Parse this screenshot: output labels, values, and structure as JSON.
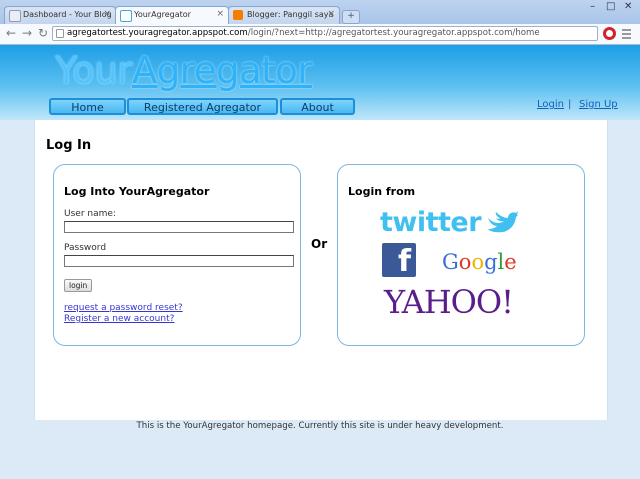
{
  "browser": {
    "tabs": [
      {
        "title": "Dashboard - Your Blog",
        "icon": "blogger-dashboard-icon",
        "active": false
      },
      {
        "title": "YourAgregator",
        "icon": "page-icon",
        "active": true
      },
      {
        "title": "Blogger: Panggil saya",
        "icon": "blogger-icon",
        "active": false
      }
    ],
    "new_tab": "+",
    "url_host": "agregatortest.youragregator.appspot.com",
    "url_rest": "/login/?next=http://agregatortest.youragregator.appspot.com/home",
    "win_minimize": "–",
    "win_maximize": "□",
    "win_close": "✕",
    "back": "←",
    "forward": "→",
    "reload": "↻",
    "close_glyph": "×"
  },
  "header": {
    "logo_part1": "Your",
    "logo_part2": "Agregator",
    "nav": [
      "Home",
      "Registered Agregator",
      "About"
    ],
    "login_link": "Login",
    "separator": "|",
    "signup_link": "Sign Up"
  },
  "main": {
    "page_title": "Log In",
    "login_panel": {
      "heading": "Log Into YourAgregator",
      "username_label": "User name:",
      "password_label": "Password",
      "username_value": "",
      "password_value": "",
      "submit_label": "login",
      "reset_link": "request a password reset?",
      "register_link": "Register a new account?"
    },
    "or_text": "Or",
    "providers": {
      "heading": "Login from",
      "twitter": "twitter",
      "facebook": "f",
      "google_letters": [
        "G",
        "o",
        "o",
        "g",
        "l",
        "e"
      ],
      "yahoo": "YAHOO!"
    }
  },
  "footer": {
    "text": "This is the YourAgregator homepage. Currently this site is under heavy development."
  },
  "colors": {
    "google": [
      "#3a6fd8",
      "#d83a2a",
      "#f0b400",
      "#3a6fd8",
      "#2f9d3c",
      "#d83a2a"
    ]
  }
}
